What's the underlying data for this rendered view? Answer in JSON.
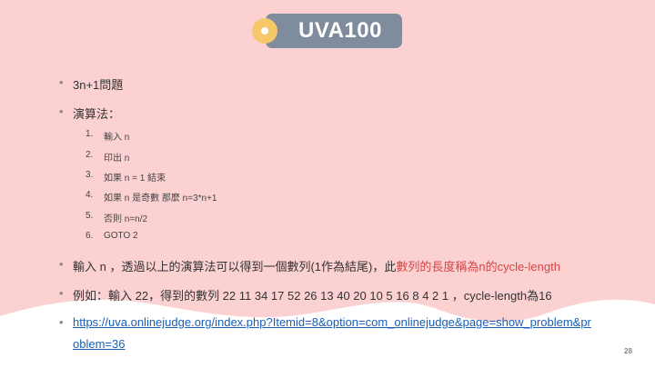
{
  "slide": {
    "title": "UVA100",
    "page_number": "28",
    "bullets": {
      "b1": "3n+1問題",
      "b2": "演算法：",
      "b3_prefix": "輸入 n ，透過以上的演算法可以得到一個數列(1作為結尾)，此",
      "b3_highlight": "數列的長度稱為n的cycle-length",
      "b4": "例如：輸入 22，得到的數列 22 11 34 17 52 26 13 40 20 10 5 16 8 4 2 1 ，cycle-length為16",
      "link_line1": "https://uva.onlinejudge.org/index.php?Itemid=8&option=com_onlinejudge&page=show_problem&pr",
      "link_line2": "oblem=36"
    },
    "steps": [
      {
        "num": "1.",
        "text": "輸入 n"
      },
      {
        "num": "2.",
        "text": "印出 n"
      },
      {
        "num": "3.",
        "text": "如果 n = 1 結束"
      },
      {
        "num": "4.",
        "text": "如果 n 是奇數 那麼 n=3*n+1"
      },
      {
        "num": "5.",
        "text": "否則 n=n/2"
      },
      {
        "num": "6.",
        "text": "GOTO 2"
      }
    ]
  }
}
